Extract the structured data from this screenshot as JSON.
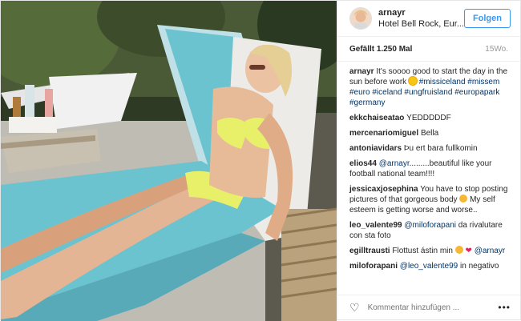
{
  "header": {
    "username": "arnayr",
    "location": "Hotel Bell Rock, Eur...",
    "follow_label": "Folgen"
  },
  "meta": {
    "likes": "Gefällt 1.250 Mal",
    "time": "15Wo."
  },
  "caption": {
    "user": "arnayr",
    "text_before_emoji": "It's soooo good to start the day in the sun before work",
    "emoji": "sun",
    "hashtags": "#missiceland #missem #euro #iceland #ungfruisland #europapark #germany"
  },
  "comments": [
    {
      "user": "ekkchaiseataо",
      "text": "YEDDDDDF"
    },
    {
      "user": "mercenariomiguel",
      "text": "Bella"
    },
    {
      "user": "antoniavidars",
      "text": "Þu ert bara fullkomin"
    },
    {
      "user": "elios44",
      "mention": "@arnayr",
      "text": ".........beautiful like your football national team!!!!"
    },
    {
      "user": "jessicaxjosephina",
      "text": "You have to stop posting pictures of that gorgeous body",
      "text2": "My self esteem is getting worse and worse.."
    },
    {
      "user": "leo_valente99",
      "mention": "@miloforapani",
      "text": "da rivalutare con sta foto"
    },
    {
      "user": "egilltrausti",
      "text": "Flottust ástin min",
      "mention2": "@arnayr"
    },
    {
      "user": "miloforapani",
      "mention": "@leo_valente99",
      "text": "in negativo"
    }
  ],
  "footer": {
    "placeholder": "Kommentar hinzufügen ...",
    "heart_icon": "heart-outline-icon",
    "more_icon": "more-dots-icon"
  }
}
